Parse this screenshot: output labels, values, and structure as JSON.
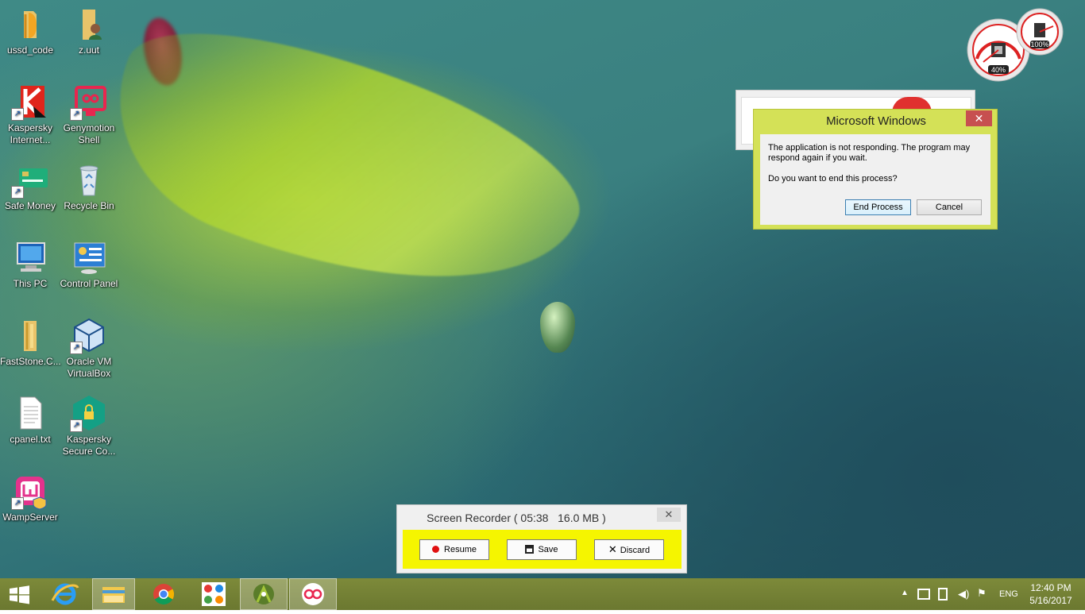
{
  "desktop_icons": [
    {
      "label": "ussd_code"
    },
    {
      "label": "z.uut"
    },
    {
      "label": "Kaspersky Internet..."
    },
    {
      "label": "Genymotion Shell"
    },
    {
      "label": "Safe Money"
    },
    {
      "label": "Recycle Bin"
    },
    {
      "label": "This PC"
    },
    {
      "label": "Control Panel"
    },
    {
      "label": "FastStone.C..."
    },
    {
      "label": "Oracle VM VirtualBox"
    },
    {
      "label": "cpanel.txt"
    },
    {
      "label": "Kaspersky Secure Co..."
    },
    {
      "label": "WampServer"
    }
  ],
  "gadget": {
    "cpu_percent": "40%",
    "memory_percent": "100%",
    "cpu_value": 0.4,
    "memory_value": 1.0
  },
  "dialog": {
    "title": "Microsoft Windows",
    "close_glyph": "✕",
    "message": "The application is not responding. The program may respond again if you wait.",
    "question": "Do you want to end this process?",
    "end_process_label": "End Process",
    "cancel_label": "Cancel"
  },
  "recorder": {
    "title": "Screen Recorder ( 05:38   16.0 MB )",
    "close_glyph": "✕",
    "resume_label": "Resume",
    "save_label": "Save",
    "discard_label": "Discard"
  },
  "taskbar": {
    "apps": [
      "windows-start",
      "internet-explorer",
      "file-explorer",
      "chrome",
      "control-panel-app",
      "android-studio",
      "genymotion"
    ],
    "language": "ENG",
    "time": "12:40 PM",
    "date": "5/16/2017"
  },
  "colors": {
    "dialog_frame": "#d4e157",
    "recorder_bar": "#f5f500",
    "taskbar": "#75823a"
  }
}
